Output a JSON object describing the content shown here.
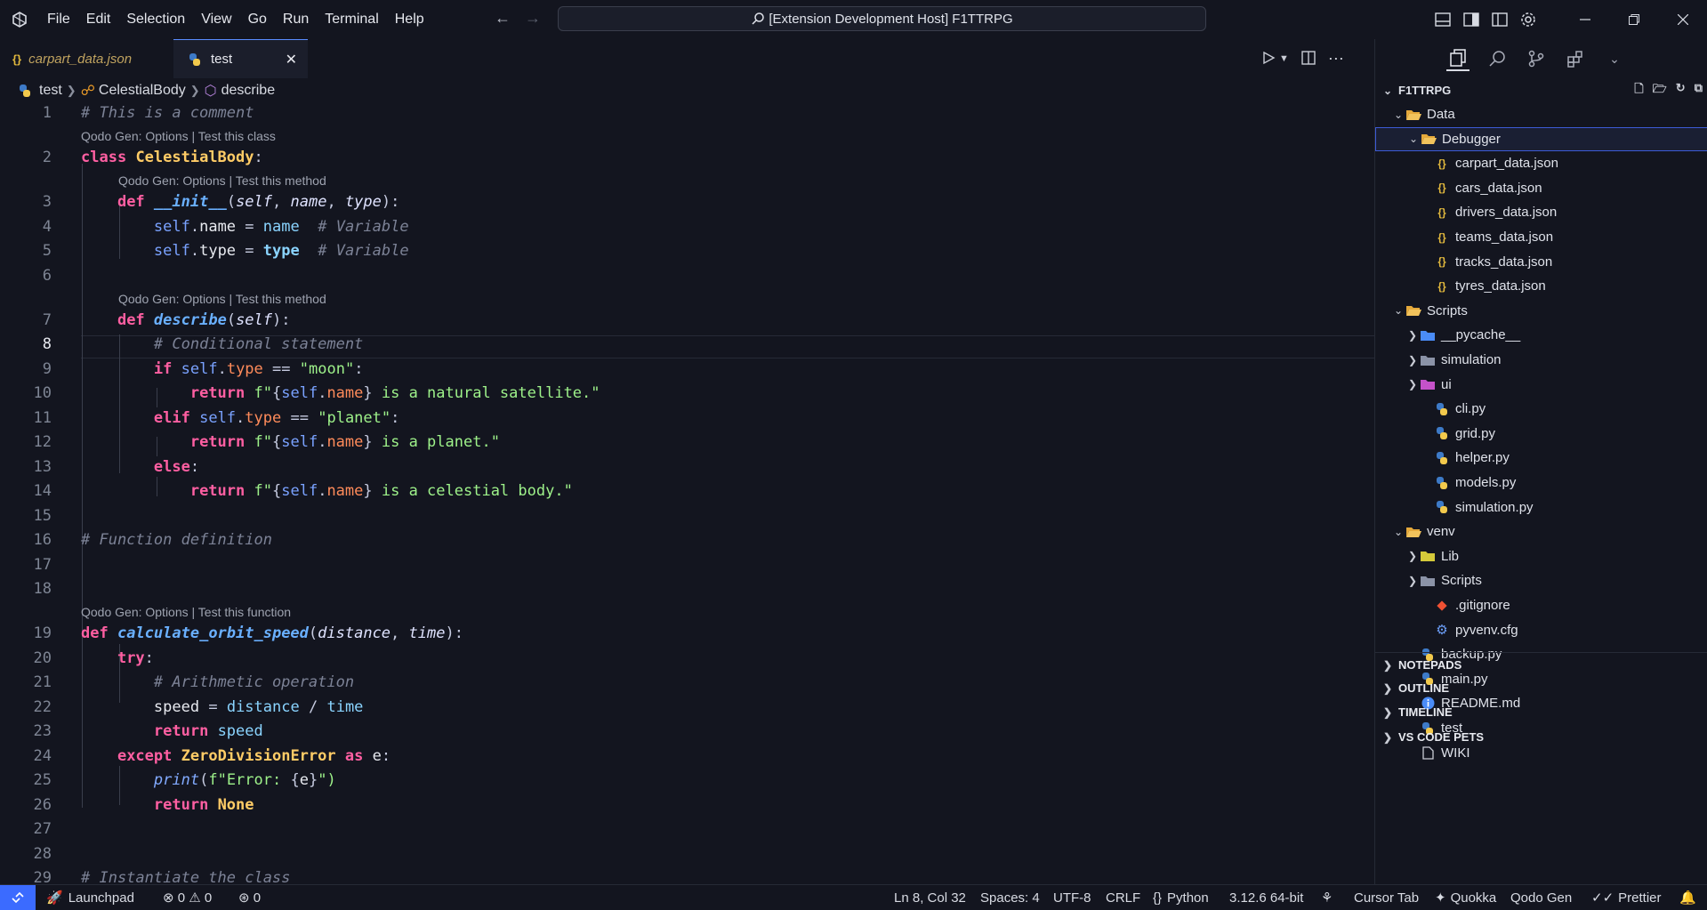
{
  "menu": [
    "File",
    "Edit",
    "Selection",
    "View",
    "Go",
    "Run",
    "Terminal",
    "Help"
  ],
  "command_center": "[Extension Development Host] F1TTRPG",
  "tabs": [
    {
      "label": "carpart_data.json"
    },
    {
      "label": "test"
    }
  ],
  "breadcrumb": [
    "test",
    "CelestialBody",
    "describe"
  ],
  "editor": {
    "lines": [
      {
        "n": "1"
      },
      {
        "n": "2"
      },
      {
        "n": "3"
      },
      {
        "n": "4"
      },
      {
        "n": "5"
      },
      {
        "n": "6"
      },
      {
        "n": "7"
      },
      {
        "n": "8"
      },
      {
        "n": "9"
      },
      {
        "n": "10"
      },
      {
        "n": "11"
      },
      {
        "n": "12"
      },
      {
        "n": "13"
      },
      {
        "n": "14"
      },
      {
        "n": "15"
      },
      {
        "n": "16"
      },
      {
        "n": "17"
      },
      {
        "n": "18"
      },
      {
        "n": "19"
      },
      {
        "n": "20"
      },
      {
        "n": "21"
      },
      {
        "n": "22"
      },
      {
        "n": "23"
      },
      {
        "n": "24"
      },
      {
        "n": "25"
      },
      {
        "n": "26"
      },
      {
        "n": "27"
      },
      {
        "n": "28"
      },
      {
        "n": "29"
      }
    ],
    "lens_class": "Qodo Gen: Options | Test this class",
    "lens_method": "Qodo Gen: Options | Test this method",
    "lens_function": "Qodo Gen: Options | Test this function",
    "code": {
      "c1": "# This is a comment",
      "c4": "# Variable",
      "c8": "# Conditional statement",
      "c16": "# Function definition",
      "c21": "# Arithmetic operation",
      "c29": "# Instantiate the class",
      "class_kw": "class",
      "class_name": "CelestialBody",
      "def_kw": "def",
      "init_name": "__init__",
      "describe_name": "describe",
      "calc_name": "calculate_orbit_speed",
      "self": "self",
      "name": "name",
      "type": "type",
      "distance": "distance",
      "time": "time",
      "if_kw": "if",
      "elif_kw": "elif",
      "else_kw": "else",
      "return_kw": "return",
      "try_kw": "try",
      "except_kw": "except",
      "as_kw": "as",
      "moon_str": "\"moon\"",
      "planet_str": "\"planet\"",
      "ret1": " is a natural satellite.\"",
      "ret2": " is a planet.\"",
      "ret3": " is a celestial body.\"",
      "speed": "speed",
      "error_cls": "ZeroDivisionError",
      "e": "e",
      "print": "print",
      "err_str": "\"Error: ",
      "none": "None"
    }
  },
  "explorer": {
    "root": "F1TTRPG",
    "items": [
      {
        "label": "Data",
        "depth": 1,
        "kind": "folder-open",
        "icon": "folder-open-icon"
      },
      {
        "label": "Debugger",
        "depth": 2,
        "kind": "folder-open",
        "icon": "folder-open-icon",
        "selected": true
      },
      {
        "label": "carpart_data.json",
        "depth": 3,
        "icon": "json-icon"
      },
      {
        "label": "cars_data.json",
        "depth": 3,
        "icon": "json-icon"
      },
      {
        "label": "drivers_data.json",
        "depth": 3,
        "icon": "json-icon"
      },
      {
        "label": "teams_data.json",
        "depth": 3,
        "icon": "json-icon"
      },
      {
        "label": "tracks_data.json",
        "depth": 3,
        "icon": "json-icon"
      },
      {
        "label": "tyres_data.json",
        "depth": 3,
        "icon": "json-icon"
      },
      {
        "label": "Scripts",
        "depth": 1,
        "kind": "folder-open",
        "icon": "folder-open-icon"
      },
      {
        "label": "__pycache__",
        "depth": 2,
        "kind": "folder",
        "icon": "folder-icon"
      },
      {
        "label": "simulation",
        "depth": 2,
        "kind": "folder",
        "icon": "folder-icon"
      },
      {
        "label": "ui",
        "depth": 2,
        "kind": "folder",
        "icon": "folder-icon"
      },
      {
        "label": "cli.py",
        "depth": 3,
        "icon": "python-icon"
      },
      {
        "label": "grid.py",
        "depth": 3,
        "icon": "python-icon"
      },
      {
        "label": "helper.py",
        "depth": 3,
        "icon": "python-icon"
      },
      {
        "label": "models.py",
        "depth": 3,
        "icon": "python-icon"
      },
      {
        "label": "simulation.py",
        "depth": 3,
        "icon": "python-icon"
      },
      {
        "label": "venv",
        "depth": 1,
        "kind": "folder-open",
        "icon": "folder-open-icon"
      },
      {
        "label": "Lib",
        "depth": 2,
        "kind": "folder",
        "icon": "folder-icon"
      },
      {
        "label": "Scripts",
        "depth": 2,
        "kind": "folder",
        "icon": "folder-icon"
      },
      {
        "label": ".gitignore",
        "depth": 3,
        "icon": "git-icon"
      },
      {
        "label": "pyvenv.cfg",
        "depth": 3,
        "icon": "gear-icon"
      },
      {
        "label": "backup.py",
        "depth": 2,
        "icon": "python-icon"
      },
      {
        "label": "main.py",
        "depth": 2,
        "icon": "python-icon"
      },
      {
        "label": "README.md",
        "depth": 2,
        "icon": "info-icon"
      },
      {
        "label": "test",
        "depth": 2,
        "icon": "python-icon"
      },
      {
        "label": "WIKI",
        "depth": 2,
        "icon": "file-icon"
      }
    ],
    "sections": [
      "NOTEPADS",
      "OUTLINE",
      "TIMELINE",
      "VS CODE PETS"
    ]
  },
  "status": {
    "launchpad": "Launchpad",
    "errors": "0",
    "warnings": "0",
    "ports": "0",
    "position": "Ln 8, Col 32",
    "spaces": "Spaces: 4",
    "encoding": "UTF-8",
    "eol": "CRLF",
    "language": "Python",
    "interpreter": "3.12.6 64-bit",
    "cursor_tab": "Cursor Tab",
    "quokka": "Quokka",
    "qodo": "Qodo Gen",
    "prettier": "Prettier"
  },
  "colors": {
    "accent": "#3b6bff",
    "background": "#13151f",
    "keyword": "#ff5fa2",
    "function": "#6ab0ff",
    "class": "#ffcc66",
    "string": "#9ef28a"
  }
}
